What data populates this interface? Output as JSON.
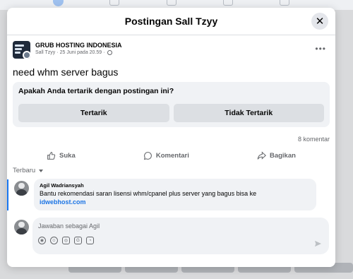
{
  "colors": {
    "accent": "#1877f2",
    "link": "#1b74e4",
    "muted": "#65676b",
    "surface": "#f0f2f5"
  },
  "modal": {
    "title": "Postingan Sall Tzyy",
    "close_icon": "close-icon"
  },
  "post": {
    "page_name": "GRUB HOSTING INDONESIA",
    "author": "Sall Tzyy",
    "date": "25 Juni pada 20.59",
    "separator": "·",
    "text": "need whm server bagus"
  },
  "interest": {
    "question": "Apakah Anda tertarik dengan postingan ini?",
    "yes": "Tertarik",
    "no": "Tidak Tertarik"
  },
  "stats": {
    "comments": "8 komentar"
  },
  "actions": {
    "like": "Suka",
    "comment": "Komentari",
    "share": "Bagikan"
  },
  "sort": {
    "label": "Terbaru"
  },
  "comment": {
    "author": "Agil Wadriansyah",
    "text": "Bantu rekomendasi saran lisensi whm/cpanel plus server yang bagus bisa ke",
    "link": "idwebhost.com"
  },
  "reply": {
    "placeholder": "Jawaban sebagai Agil",
    "icons": [
      "avatar-sticker-icon",
      "emoji-icon",
      "camera-icon",
      "gif-icon",
      "sticker-icon"
    ],
    "send_icon": "send-icon"
  }
}
